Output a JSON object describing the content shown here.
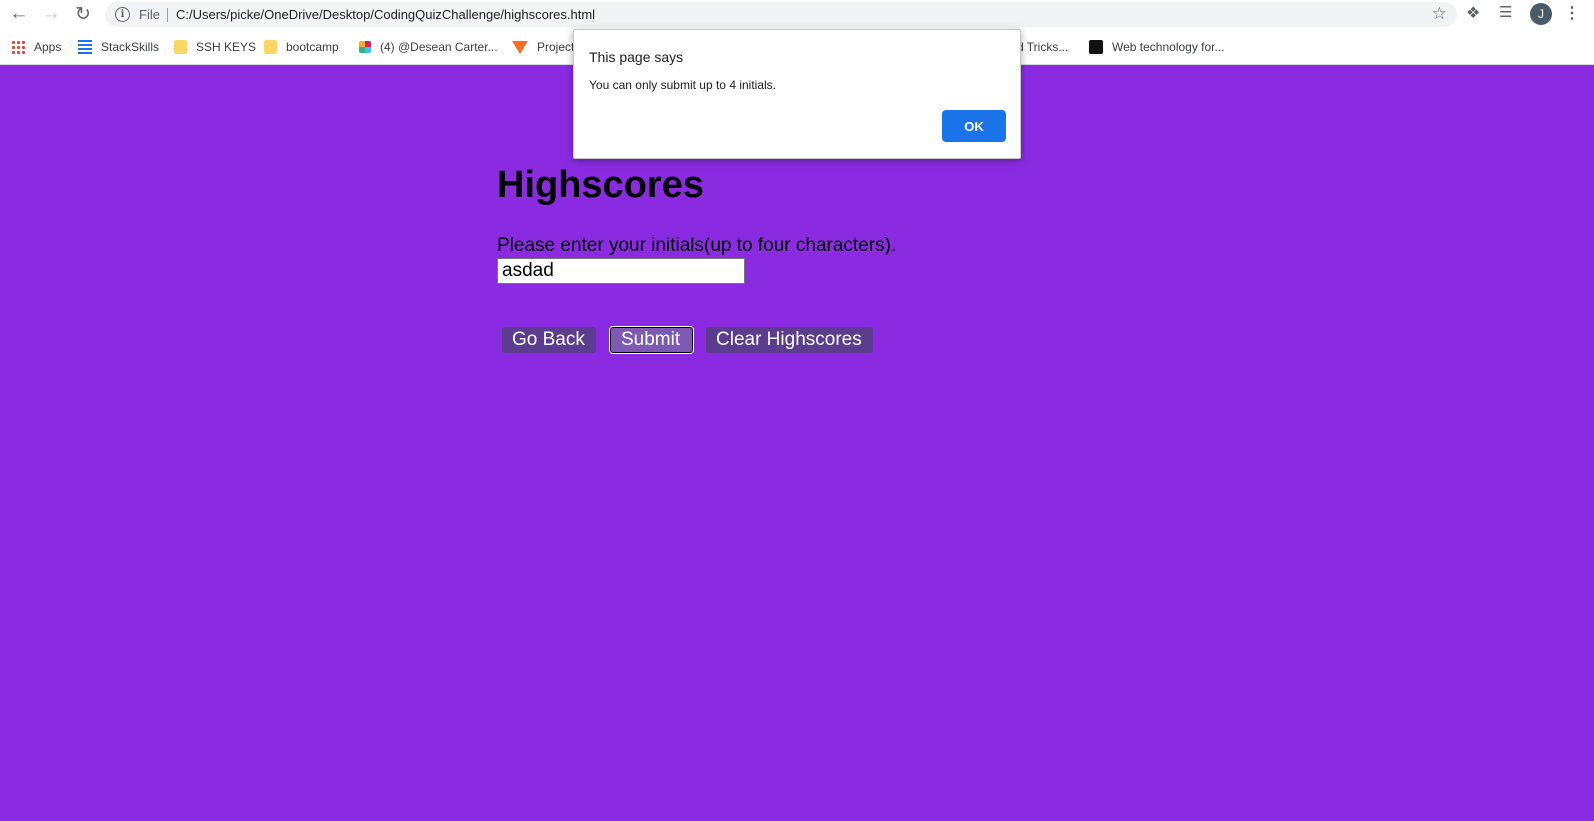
{
  "browser": {
    "scheme_label": "File",
    "url": "C:/Users/picke/OneDrive/Desktop/CodingQuizChallenge/highscores.html",
    "profile_initial": "J",
    "bookmarks": [
      {
        "label": "Apps",
        "icon": "apps-grid-icon"
      },
      {
        "label": "StackSkills",
        "icon": "stackskills-icon"
      },
      {
        "label": "SSH KEYS",
        "icon": "folder-icon"
      },
      {
        "label": "bootcamp",
        "icon": "folder-icon"
      },
      {
        "label": "(4) @Desean Carter...",
        "icon": "slack-icon"
      },
      {
        "label": "Project",
        "icon": "gitlab-icon"
      },
      {
        "label": "d Tricks...",
        "icon": "none"
      },
      {
        "label": "Web technology for...",
        "icon": "webtech-icon"
      }
    ]
  },
  "page": {
    "title": "Highscores",
    "prompt": "Please enter your initials(up to four characters).",
    "initials_value": "asdad",
    "buttons": {
      "go_back": "Go Back",
      "submit": "Submit",
      "clear": "Clear Highscores"
    },
    "background_color": "#8a2be2"
  },
  "dialog": {
    "title": "This page says",
    "message": "You can only submit up to 4 initials.",
    "ok_label": "OK"
  }
}
